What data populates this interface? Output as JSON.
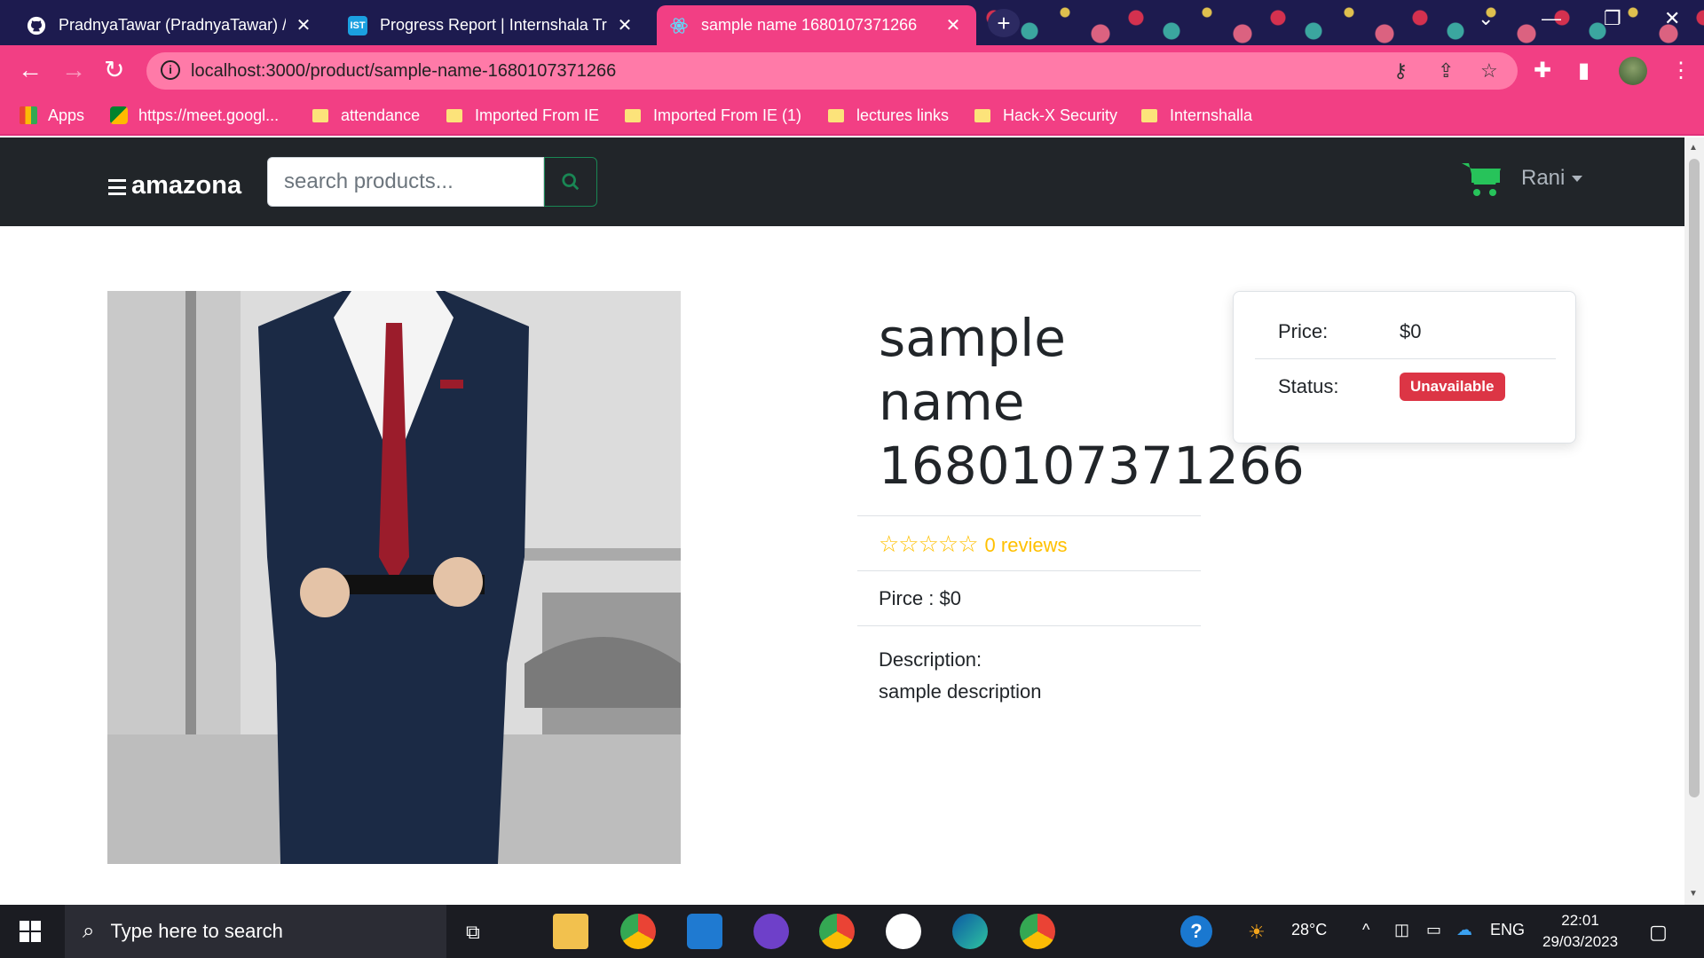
{
  "browser": {
    "tabs": [
      {
        "title": "PradnyaTawar (PradnyaTawar) / R",
        "favicon": "github-icon",
        "active": false
      },
      {
        "title": "Progress Report | Internshala Trai",
        "favicon": "IST",
        "active": false
      },
      {
        "title": "sample name 1680107371266",
        "favicon": "react-icon",
        "active": true
      }
    ],
    "url": "localhost:3000/product/sample-name-1680107371266",
    "bookmarks": [
      "Apps",
      "https://meet.googl...",
      "attendance",
      "Imported From IE",
      "Imported From IE (1)",
      "lectures links",
      "Hack-X Security",
      "Internshalla"
    ]
  },
  "app": {
    "brand": "amazona",
    "search_placeholder": "search products...",
    "user_name": "Rani",
    "cart_icon": "shopping-cart-icon",
    "accent": "#198754"
  },
  "product": {
    "name": "sample name 1680107371266",
    "name_lines": [
      "sample",
      "name",
      "1680107371266"
    ],
    "rating": 0,
    "reviews_text": "0 reviews",
    "price_line": "Pirce : $0",
    "description_label": "Description:",
    "description": "sample description"
  },
  "card": {
    "price_label": "Price:",
    "price_value": "$0",
    "status_label": "Status:",
    "status_value": "Unavailable",
    "status_color": "#dc3545"
  },
  "taskbar": {
    "search_placeholder": "Type here to search",
    "weather": "28°C",
    "language": "ENG",
    "time": "22:01",
    "date": "29/03/2023"
  }
}
